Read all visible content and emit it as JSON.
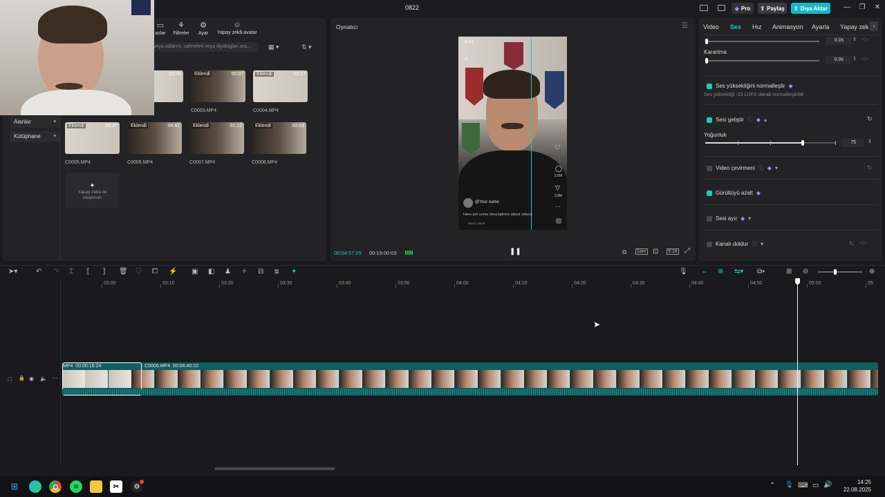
{
  "window": {
    "title": "0822",
    "pro_label": "Pro",
    "share_label": "Paylaş",
    "export_label": "Dışa Aktar"
  },
  "media_panel": {
    "tools": [
      {
        "label": "azlar"
      },
      {
        "label": "Filtreler"
      },
      {
        "label": "Ayar"
      },
      {
        "label": "Yapay zekâ avatar"
      }
    ],
    "search_placeholder": "veya adlarını, sahneleri veya diyalogları ara...",
    "sidebar": [
      {
        "label": "Alanlar"
      },
      {
        "label": "Kütüphane"
      }
    ],
    "clips": [
      {
        "name": "",
        "badge": "",
        "duration": "02:36",
        "style": "wall"
      },
      {
        "name": "C0003.MP4",
        "badge": "Eklendi",
        "duration": "00:07",
        "style": "dark"
      },
      {
        "name": "C0004.MP4",
        "badge": "Eklendi",
        "duration": "02:17",
        "style": "wall"
      },
      {
        "name": "C0005.MP4",
        "badge": "Eklendi",
        "duration": "00:37",
        "style": "wall"
      },
      {
        "name": "C0006.MP4",
        "badge": "Eklendi",
        "duration": "04:41",
        "style": "dark"
      },
      {
        "name": "C0007.MP4",
        "badge": "Eklendi",
        "duration": "01:12",
        "style": "dark"
      },
      {
        "name": "C0008.MP4",
        "badge": "Eklendi",
        "duration": "00:03",
        "style": "dark"
      }
    ],
    "ai_create_label": "Yapay zekâ ile oluşturun"
  },
  "player": {
    "title": "Oynatıcı",
    "current_time": "00:04:57:29",
    "total_time": "00:15:00:03",
    "phone": {
      "clock": "9:41",
      "username": "@Your name",
      "description": "Here are some descriptions about videos",
      "music": "Music name",
      "like_count": "2.8M",
      "comment_count": "2.8M"
    }
  },
  "inspector": {
    "tabs": [
      {
        "label": "Video"
      },
      {
        "label": "Ses"
      },
      {
        "label": "Hız"
      },
      {
        "label": "Animasyon"
      },
      {
        "label": "Ayarla"
      },
      {
        "label": "Yapay zek"
      }
    ],
    "active_tab": "Ses",
    "fade_in_value": "0.0s",
    "fade_out_label": "Karartma",
    "fade_out_value": "0.0s",
    "normalize_label": "Ses yüksekliğini normalleştir",
    "normalize_desc": "Ses yüksekliği -23 LUFS olarak normalleştirildi",
    "enhance_label": "Sesi geliştir",
    "intensity_label": "Yoğunluk",
    "intensity_value": "75",
    "intensity": 0.75,
    "translate_label": "Video çevirmeni",
    "denoise_label": "Gürültüyü azalt",
    "separate_label": "Sesi ayır",
    "channel_label": "Kanalı doldur"
  },
  "timeline": {
    "ruler": [
      "03:00",
      "03:10",
      "03:20",
      "03:30",
      "03:40",
      "03:50",
      "04:00",
      "04:10",
      "04:20",
      "04:30",
      "04:40",
      "04:50",
      "05:00",
      "05:"
    ],
    "clip1_label": "MP4  00:00:16:24",
    "clip2_label": "C0006.MP4  00:04:40:10"
  },
  "taskbar": {
    "time": "14:25",
    "date": "22.08.2025"
  },
  "colors": {
    "accent": "#1cc9c0",
    "pro": "#8a7cf0",
    "export": "#14b8c8",
    "track": "#0f5e60"
  }
}
